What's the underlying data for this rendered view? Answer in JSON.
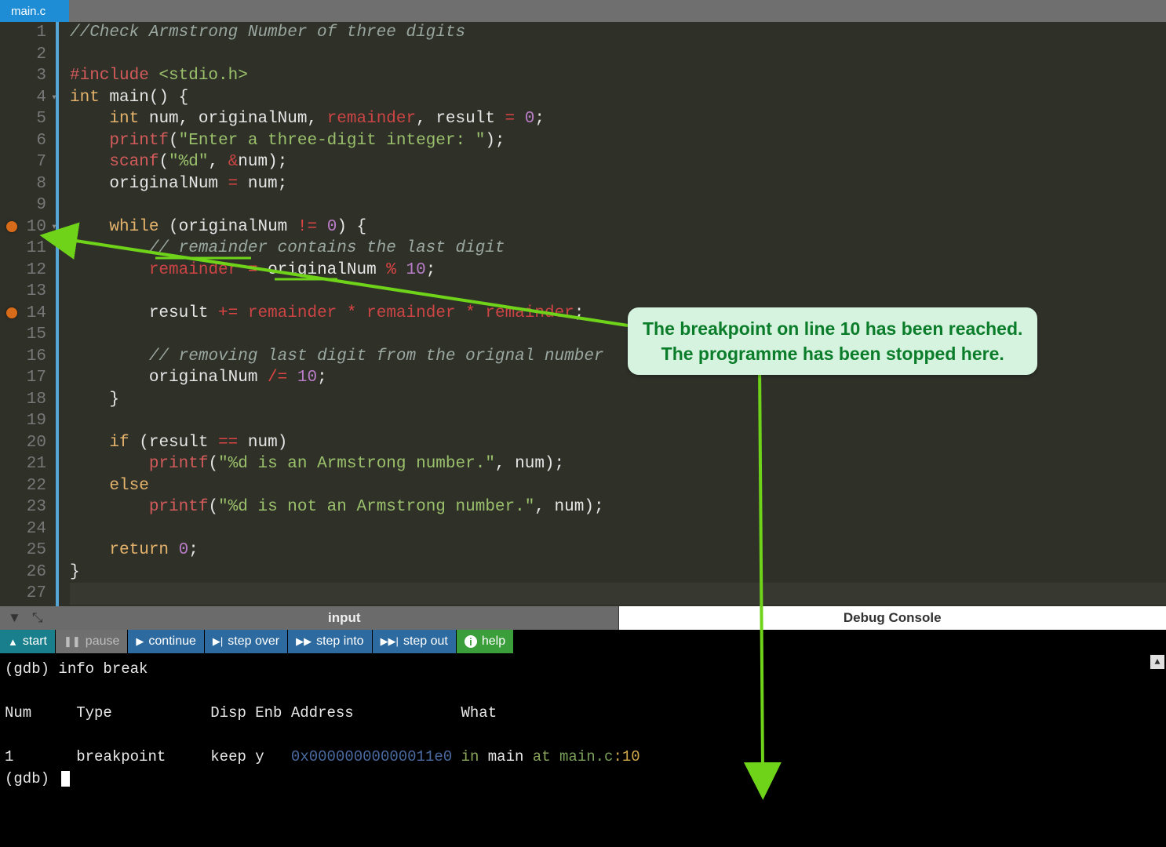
{
  "tab": {
    "label": "main.c"
  },
  "editor": {
    "breakpoints": [
      10,
      14
    ],
    "folds": [
      4,
      10
    ],
    "lines": [
      {
        "n": 1,
        "tokens": [
          [
            "c-comment",
            "//Check Armstrong Number of three digits"
          ]
        ]
      },
      {
        "n": 2,
        "tokens": []
      },
      {
        "n": 3,
        "tokens": [
          [
            "c-pre",
            "#include "
          ],
          [
            "c-inc",
            "<stdio.h>"
          ]
        ]
      },
      {
        "n": 4,
        "tokens": [
          [
            "c-kw",
            "int "
          ],
          [
            "c-def",
            "main() {"
          ]
        ]
      },
      {
        "n": 5,
        "tokens": [
          [
            "c-def",
            "    "
          ],
          [
            "c-kw",
            "int "
          ],
          [
            "c-def",
            "num, originalNum, "
          ],
          [
            "c-kw2",
            "remainder"
          ],
          [
            "c-def",
            ", result "
          ],
          [
            "c-op",
            "="
          ],
          [
            "c-def",
            " "
          ],
          [
            "c-num",
            "0"
          ],
          [
            "c-def",
            ";"
          ]
        ]
      },
      {
        "n": 6,
        "tokens": [
          [
            "c-def",
            "    "
          ],
          [
            "c-fn",
            "printf"
          ],
          [
            "c-def",
            "("
          ],
          [
            "c-str",
            "\"Enter a three-digit integer: \""
          ],
          [
            "c-def",
            ");"
          ]
        ]
      },
      {
        "n": 7,
        "tokens": [
          [
            "c-def",
            "    "
          ],
          [
            "c-fn",
            "scanf"
          ],
          [
            "c-def",
            "("
          ],
          [
            "c-str",
            "\"%d\""
          ],
          [
            "c-def",
            ", "
          ],
          [
            "c-amp",
            "&"
          ],
          [
            "c-def",
            "num);"
          ]
        ]
      },
      {
        "n": 8,
        "tokens": [
          [
            "c-def",
            "    originalNum "
          ],
          [
            "c-op",
            "="
          ],
          [
            "c-def",
            " num;"
          ]
        ]
      },
      {
        "n": 9,
        "tokens": []
      },
      {
        "n": 10,
        "tokens": [
          [
            "c-def",
            "    "
          ],
          [
            "c-kw",
            "while "
          ],
          [
            "c-def",
            "(originalNum "
          ],
          [
            "c-op",
            "!="
          ],
          [
            "c-def",
            " "
          ],
          [
            "c-num",
            "0"
          ],
          [
            "c-def",
            ") {"
          ]
        ]
      },
      {
        "n": 11,
        "tokens": [
          [
            "c-def",
            "        "
          ],
          [
            "c-comment",
            "// remainder contains the last digit"
          ],
          [
            "c-def",
            ""
          ]
        ]
      },
      {
        "n": 12,
        "tokens": [
          [
            "c-def",
            "        "
          ],
          [
            "c-kw2",
            "remainder "
          ],
          [
            "c-op",
            "="
          ],
          [
            "c-def",
            " originalNum "
          ],
          [
            "c-op",
            "%"
          ],
          [
            "c-def",
            " "
          ],
          [
            "c-num",
            "10"
          ],
          [
            "c-def",
            ";"
          ]
        ]
      },
      {
        "n": 13,
        "tokens": []
      },
      {
        "n": 14,
        "tokens": [
          [
            "c-def",
            "        result "
          ],
          [
            "c-op",
            "+="
          ],
          [
            "c-def",
            " "
          ],
          [
            "c-kw2",
            "remainder "
          ],
          [
            "c-op",
            "*"
          ],
          [
            "c-def",
            " "
          ],
          [
            "c-kw2",
            "remainder "
          ],
          [
            "c-op",
            "*"
          ],
          [
            "c-def",
            " "
          ],
          [
            "c-kw2",
            "remainder"
          ],
          [
            "c-def",
            ";"
          ]
        ]
      },
      {
        "n": 15,
        "tokens": []
      },
      {
        "n": 16,
        "tokens": [
          [
            "c-def",
            "        "
          ],
          [
            "c-comment",
            "// removing last digit from the orignal number"
          ]
        ]
      },
      {
        "n": 17,
        "tokens": [
          [
            "c-def",
            "        originalNum "
          ],
          [
            "c-op",
            "/="
          ],
          [
            "c-def",
            " "
          ],
          [
            "c-num",
            "10"
          ],
          [
            "c-def",
            ";"
          ]
        ]
      },
      {
        "n": 18,
        "tokens": [
          [
            "c-def",
            "    }"
          ]
        ]
      },
      {
        "n": 19,
        "tokens": []
      },
      {
        "n": 20,
        "tokens": [
          [
            "c-def",
            "    "
          ],
          [
            "c-kw",
            "if "
          ],
          [
            "c-def",
            "(result "
          ],
          [
            "c-op",
            "=="
          ],
          [
            "c-def",
            " num)"
          ]
        ]
      },
      {
        "n": 21,
        "tokens": [
          [
            "c-def",
            "        "
          ],
          [
            "c-fn",
            "printf"
          ],
          [
            "c-def",
            "("
          ],
          [
            "c-str",
            "\"%d is an Armstrong number.\""
          ],
          [
            "c-def",
            ", num);"
          ]
        ]
      },
      {
        "n": 22,
        "tokens": [
          [
            "c-def",
            "    "
          ],
          [
            "c-kw",
            "else"
          ]
        ]
      },
      {
        "n": 23,
        "tokens": [
          [
            "c-def",
            "        "
          ],
          [
            "c-fn",
            "printf"
          ],
          [
            "c-def",
            "("
          ],
          [
            "c-str",
            "\"%d is not an Armstrong number.\""
          ],
          [
            "c-def",
            ", num);"
          ]
        ]
      },
      {
        "n": 24,
        "tokens": []
      },
      {
        "n": 25,
        "tokens": [
          [
            "c-def",
            "    "
          ],
          [
            "c-kw",
            "return "
          ],
          [
            "c-num",
            "0"
          ],
          [
            "c-def",
            ";"
          ]
        ]
      },
      {
        "n": 26,
        "tokens": [
          [
            "c-def",
            "}"
          ]
        ]
      },
      {
        "n": 27,
        "tokens": [],
        "current": true
      }
    ]
  },
  "panel": {
    "input_label": "input",
    "debug_label": "Debug Console"
  },
  "dbgbar": {
    "start": "start",
    "pause": "pause",
    "continue": "continue",
    "stepover": "step over",
    "stepinto": "step into",
    "stepout": "step out",
    "help": "help"
  },
  "console": {
    "cmd1": "(gdb) info break",
    "hdr": "Num     Type           Disp Enb Address            What",
    "row_num": "1",
    "row_type": "breakpoint",
    "row_disp": "keep",
    "row_enb": "y",
    "row_addr": "0x00000000000011e0",
    "row_in": "in",
    "row_main": "main",
    "row_at": "at",
    "row_file": "main.c",
    "row_line": ":10",
    "prompt": "(gdb) "
  },
  "callout": {
    "line1": "The breakpoint on line 10 has been reached.",
    "line2": "The programme has been stopped here."
  }
}
